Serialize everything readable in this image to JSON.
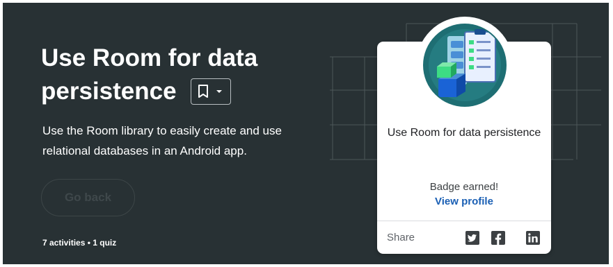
{
  "course": {
    "title_line1": "Use Room for data",
    "title_line2": "persistence",
    "subtitle": "Use the Room library to easily create and use relational databases in an Android app.",
    "go_back_label": "Go back",
    "meta": "7 activities • 1 quiz"
  },
  "badge": {
    "title": "Use Room for data persistence",
    "status": "Badge earned!",
    "view_profile_label": "View profile",
    "share_label": "Share",
    "social_icons": [
      "twitter-icon",
      "facebook-icon",
      "linkedin-icon"
    ]
  },
  "colors": {
    "hero_background": "#283134",
    "link_blue": "#1a5fb4",
    "badge_teal": "#1e6e73",
    "android_green": "#3ddc84"
  }
}
